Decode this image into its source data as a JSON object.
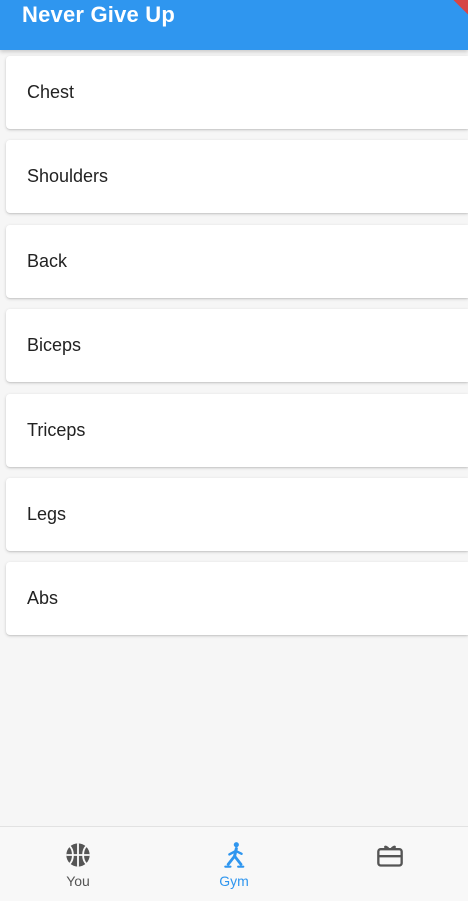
{
  "app_bar": {
    "title": "Never Give Up",
    "color": "#2f96ef"
  },
  "muscle_groups": [
    "Chest",
    "Shoulders",
    "Back",
    "Biceps",
    "Triceps",
    "Legs",
    "Abs"
  ],
  "bottom_nav": {
    "active_color": "#2f96ef",
    "inactive_color": "#555555",
    "items": [
      {
        "label": "You",
        "icon": "basketball-icon",
        "active": false
      },
      {
        "label": "Gym",
        "icon": "workout-person-icon",
        "active": true
      },
      {
        "label": "",
        "icon": "gift-card-icon",
        "active": false
      }
    ]
  }
}
